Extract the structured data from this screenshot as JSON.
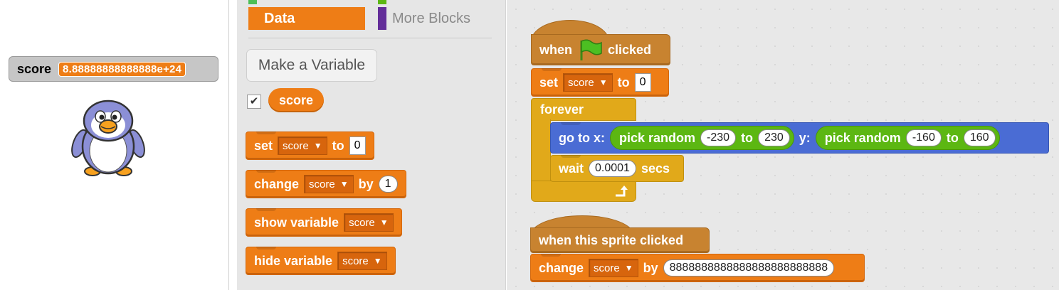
{
  "stage": {
    "monitor": {
      "label": "score",
      "value": "8.88888888888888e+24"
    },
    "sprite_icon": "penguin-sprite"
  },
  "palette": {
    "categories": {
      "data_label": "Data",
      "more_blocks_label": "More Blocks"
    },
    "make_variable_label": "Make a Variable",
    "variable_reporter": "score",
    "checkbox_checked": true,
    "blocks": {
      "set": {
        "word": "set",
        "var": "score",
        "to": "to",
        "value": "0"
      },
      "change": {
        "word": "change",
        "var": "score",
        "by": "by",
        "value": "1"
      },
      "show": {
        "word": "show variable",
        "var": "score"
      },
      "hide": {
        "word": "hide variable",
        "var": "score"
      }
    }
  },
  "scripts": {
    "script1": {
      "hat_when": "when",
      "hat_clicked": "clicked",
      "set_word": "set",
      "set_var": "score",
      "set_to": "to",
      "set_value": "0",
      "forever": "forever",
      "goto_label": "go to x:",
      "pick_random": "pick random",
      "to_word": "to",
      "y_label": "y:",
      "x_min": "-230",
      "x_max": "230",
      "y_min": "-160",
      "y_max": "160",
      "wait_word": "wait",
      "wait_value": "0.0001",
      "secs": "secs"
    },
    "script2": {
      "hat_label": "when this sprite clicked",
      "change_word": "change",
      "change_var": "score",
      "by_word": "by",
      "change_value": "8888888888888888888888888"
    }
  },
  "colors": {
    "data": "#ee7d16",
    "events": "#c88330",
    "control": "#e1a91a",
    "motion": "#4a6cd4",
    "operators": "#5cb712",
    "more_blocks": "#632d99"
  }
}
